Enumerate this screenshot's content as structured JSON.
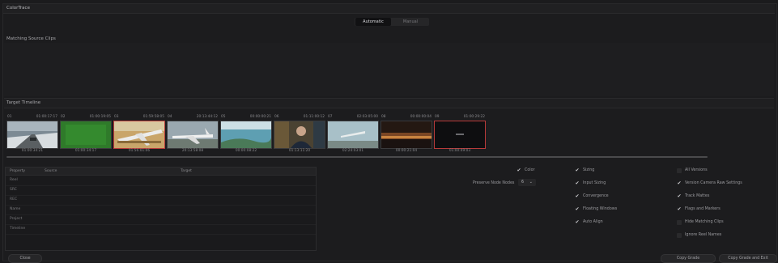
{
  "window": {
    "title": "ColorTrace"
  },
  "mode_tabs": [
    {
      "label": "Automatic",
      "active": true
    },
    {
      "label": "Manual",
      "active": false
    }
  ],
  "matching_source": {
    "title": "Matching Source Clips"
  },
  "target_timeline": {
    "title": "Target Timeline",
    "clips": [
      {
        "num": "01",
        "tc_top": "01:00:17:17",
        "tc_bottom": "01:00:34:21",
        "selected": false,
        "thumb": "snowy-road"
      },
      {
        "num": "02",
        "tc_top": "01:00:19:05",
        "tc_bottom": "01:00:34:17",
        "selected": false,
        "thumb": "green-screen"
      },
      {
        "num": "03",
        "tc_top": "01:59:58:05",
        "tc_bottom": "01:56:01:06",
        "selected": true,
        "thumb": "plane-desert"
      },
      {
        "num": "04",
        "tc_top": "20:13:44:12",
        "tc_bottom": "20:13:58:08",
        "selected": false,
        "thumb": "plane-runway"
      },
      {
        "num": "05",
        "tc_top": "00:00:00:21",
        "tc_bottom": "00:00:08:22",
        "selected": false,
        "thumb": "coastline"
      },
      {
        "num": "06",
        "tc_top": "01:11:00:12",
        "tc_bottom": "01:13:11:20",
        "selected": false,
        "thumb": "man-portrait"
      },
      {
        "num": "07",
        "tc_top": "02:03:05:00",
        "tc_bottom": "02:24:03:01",
        "selected": false,
        "thumb": "plane-takeoff"
      },
      {
        "num": "08",
        "tc_top": "00:00:00:04",
        "tc_bottom": "00:00:21:04",
        "selected": false,
        "thumb": "night-city"
      },
      {
        "num": "09",
        "tc_top": "01:00:29:22",
        "tc_bottom": "01:00:49:03",
        "selected": true,
        "thumb": "dark-title"
      }
    ]
  },
  "prop_table": {
    "headers": [
      "Property",
      "Source",
      "Target"
    ],
    "rows": [
      "Reel",
      "SRC",
      "REC",
      "Name",
      "Project",
      "Timeline"
    ]
  },
  "options": {
    "color": "Color",
    "preserve_node_label": "Preserve Node Nodes",
    "preserve_node_value": "6",
    "col2": [
      "Sizing",
      "Input Sizing",
      "Convergence",
      "Floating Windows",
      "Auto Align"
    ],
    "col3": [
      {
        "label": "All Versions",
        "checked": false
      },
      {
        "label": "Version Camera Raw Settings",
        "checked": true
      },
      {
        "label": "Track Mattes",
        "checked": true
      },
      {
        "label": "Flags and Markers",
        "checked": true
      },
      {
        "label": "Hide Matching Clips",
        "checked": false
      },
      {
        "label": "Ignore Reel Names",
        "checked": false
      }
    ]
  },
  "buttons": {
    "close": "Close",
    "copy_grade": "Copy Grade",
    "copy_grade_exit": "Copy Grade and Exit"
  }
}
